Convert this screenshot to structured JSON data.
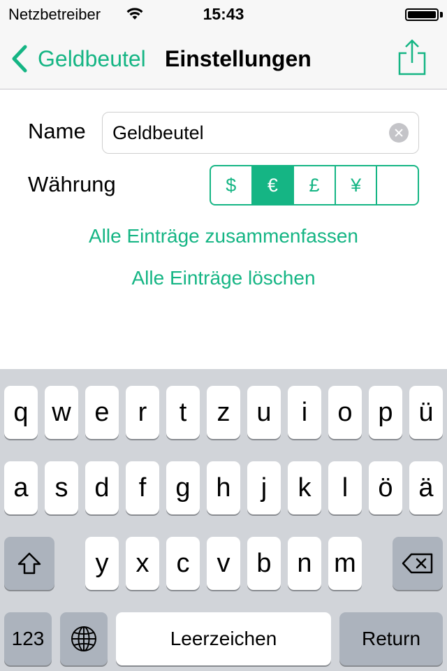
{
  "status_bar": {
    "carrier": "Netzbetreiber",
    "time": "15:43",
    "icons": [
      "wifi-icon",
      "battery-icon"
    ]
  },
  "nav_bar": {
    "back_label": "Geldbeutel",
    "title": "Einstellungen",
    "share_icon": "share-icon"
  },
  "form": {
    "name_label": "Name",
    "name_value": "Geldbeutel",
    "currency_label": "Währung",
    "currencies": [
      "$",
      "€",
      "£",
      "¥",
      ""
    ],
    "selected_currency": "€"
  },
  "actions": {
    "merge_label": "Alle Einträge zusammenfassen",
    "delete_label": "Alle Einträge löschen"
  },
  "keyboard": {
    "row1": [
      "q",
      "w",
      "e",
      "r",
      "t",
      "z",
      "u",
      "i",
      "o",
      "p",
      "ü"
    ],
    "row2": [
      "a",
      "s",
      "d",
      "f",
      "g",
      "h",
      "j",
      "k",
      "l",
      "ö",
      "ä"
    ],
    "row3": [
      "y",
      "x",
      "c",
      "v",
      "b",
      "n",
      "m"
    ],
    "numbers_label": "123",
    "space_label": "Leerzeichen",
    "return_label": "Return"
  },
  "colors": {
    "accent": "#15b584",
    "keyboard_bg": "#d1d4d9",
    "bar_bg": "#f7f7f7"
  }
}
